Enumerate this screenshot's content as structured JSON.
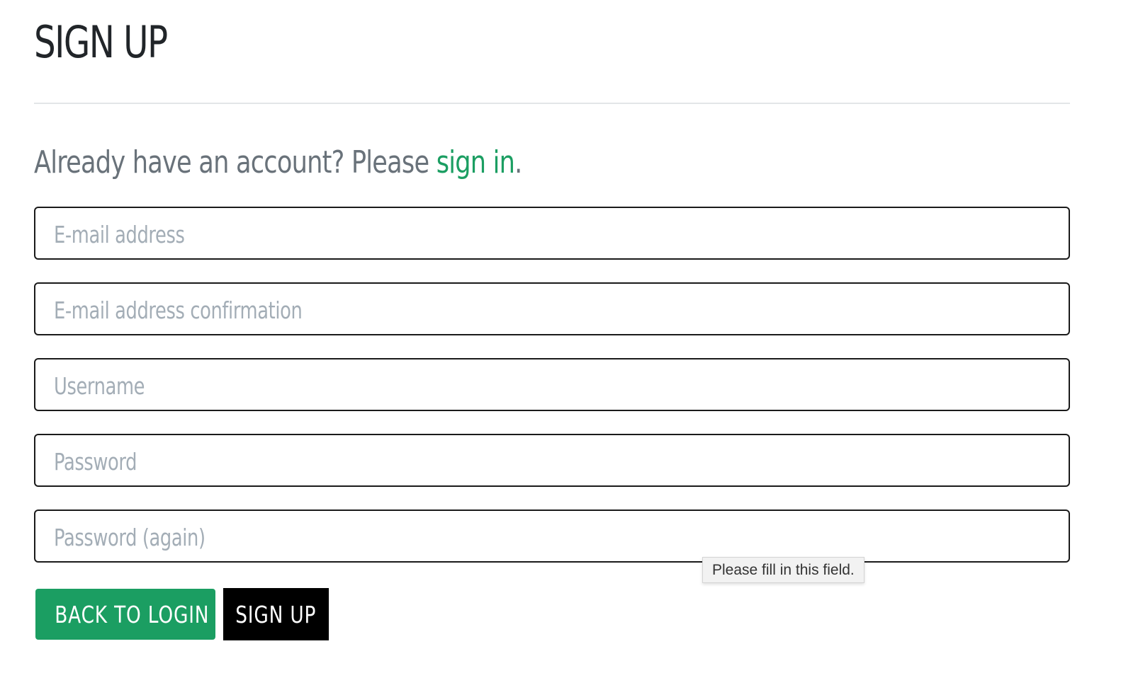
{
  "page": {
    "title": "SIGN UP"
  },
  "lead": {
    "text_before": "Already have an account? Please ",
    "link_text": "sign in",
    "text_after": "."
  },
  "form": {
    "email_placeholder": "E-mail address",
    "email_confirm_placeholder": "E-mail address confirmation",
    "username_placeholder": "Username",
    "password_placeholder": "Password",
    "password_again_placeholder": "Password (again)"
  },
  "buttons": {
    "back_label": "BACK TO LOGIN",
    "signup_label": "SIGN UP"
  },
  "validation": {
    "tooltip": "Please fill in this field."
  },
  "colors": {
    "accent": "#1b9e62",
    "primary_button": "#000000",
    "text": "#212529",
    "muted": "#69727a",
    "placeholder": "#a3adb6"
  }
}
